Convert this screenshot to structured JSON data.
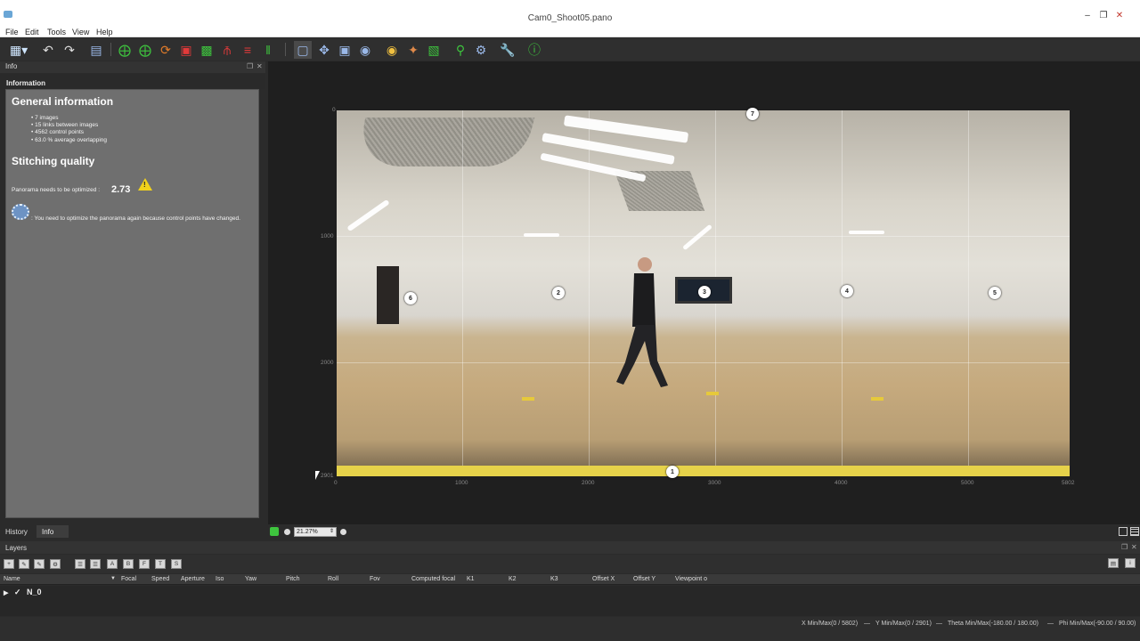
{
  "window": {
    "title": "Cam0_Shoot05.pano"
  },
  "menu": [
    "File",
    "Edit",
    "Tools",
    "View",
    "Help"
  ],
  "toolbar": {
    "icons": [
      "import-icon",
      "undo-icon",
      "redo-icon",
      "layout-icon",
      "rotate-x-icon",
      "rotate-y-icon",
      "rotate-z-icon",
      "crop-icon",
      "fit-icon",
      "horizon-icon",
      "level-icon",
      "vertical-lines-icon",
      "select-icon",
      "move-icon",
      "scale-icon",
      "center-icon",
      "auto-color-icon",
      "pose-icon",
      "blend-icon",
      "preview-icon",
      "settings-icon",
      "tools-icon",
      "help-icon"
    ]
  },
  "info_panel": {
    "dock_title": "Info",
    "heading": "Information",
    "general_title": "General information",
    "stats": [
      "7 images",
      "15 links between images",
      "4562 control points",
      "63.0 % average overlapping"
    ],
    "quality_title": "Stitching quality",
    "optimize_label": "Panorama needs to be optimized :",
    "score": "2.73",
    "message": ": You need to optimize the panorama again because control points have changed."
  },
  "left_tabs": [
    "History",
    "Info"
  ],
  "viewer": {
    "zoom": "21.27%",
    "x_ticks": [
      "0",
      "1000",
      "2000",
      "3000",
      "4000",
      "5000",
      "5802"
    ],
    "y_ticks": [
      "0",
      "1000",
      "2000",
      "2901"
    ],
    "markers": [
      "7",
      "6",
      "2",
      "3",
      "4",
      "5",
      "1"
    ]
  },
  "layers": {
    "title": "Layers",
    "toolbar_letters": [
      "A",
      "B",
      "F",
      "T",
      "S"
    ],
    "columns": [
      "Name",
      "Focal",
      "Speed",
      "Aperture",
      "Iso",
      "Yaw",
      "Pitch",
      "Roll",
      "Fov",
      "Computed focal",
      "K1",
      "K2",
      "K3",
      "Offset X",
      "Offset Y",
      "Viewpoint o"
    ],
    "row_name": "N_0"
  },
  "status": {
    "x": "X Min/Max(0 / 5802)",
    "y": "Y Min/Max(0 / 2901)",
    "theta": "Theta Min/Max(-180.00 / 180.00)",
    "phi": "Phi Min/Max(-90.00 / 90.00)"
  },
  "colors": {
    "accent_green": "#3ec43e",
    "warning": "#f2d21b",
    "panel_bg": "#6f6f6f"
  }
}
